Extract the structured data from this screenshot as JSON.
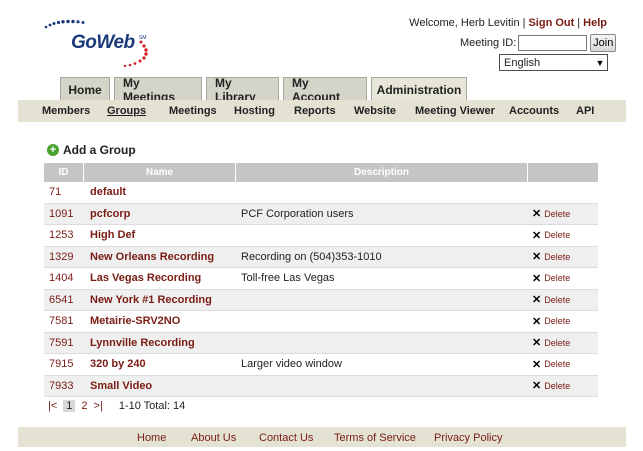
{
  "header": {
    "logo_text": "GoWeb",
    "logo_tm": "SM",
    "welcome": "Welcome, Herb Levitin",
    "sign_out": "Sign Out",
    "help": "Help",
    "meeting_id_label": "Meeting ID:",
    "meeting_id_value": "",
    "join_label": "Join",
    "language": "English"
  },
  "tabs": [
    {
      "label": "Home"
    },
    {
      "label": "My Meetings"
    },
    {
      "label": "My Library"
    },
    {
      "label": "My Account"
    },
    {
      "label": "Administration",
      "active": true
    }
  ],
  "subnav": [
    "Members",
    "Groups",
    "Meetings",
    "Hosting",
    "Reports",
    "Website",
    "Meeting Viewer",
    "Accounts",
    "API"
  ],
  "subnav_active": "Groups",
  "add_group_label": "Add a Group",
  "table": {
    "columns": [
      "ID",
      "Name",
      "Description",
      ""
    ],
    "rows": [
      {
        "id": "71",
        "name": "default",
        "description": "",
        "action": ""
      },
      {
        "id": "1091",
        "name": "pcfcorp",
        "description": "PCF Corporation users",
        "action": "Delete"
      },
      {
        "id": "1253",
        "name": "High Def",
        "description": "",
        "action": "Delete"
      },
      {
        "id": "1329",
        "name": "New Orleans Recording",
        "description": "Recording on (504)353-1010",
        "action": "Delete"
      },
      {
        "id": "1404",
        "name": "Las Vegas Recording",
        "description": "Toll-free Las Vegas",
        "action": "Delete"
      },
      {
        "id": "6541",
        "name": "New York #1 Recording",
        "description": "",
        "action": "Delete"
      },
      {
        "id": "7581",
        "name": "Metairie-SRV2NO",
        "description": "",
        "action": "Delete"
      },
      {
        "id": "7591",
        "name": "Lynnville Recording",
        "description": "",
        "action": "Delete"
      },
      {
        "id": "7915",
        "name": "320 by 240",
        "description": "Larger video window",
        "action": "Delete"
      },
      {
        "id": "7933",
        "name": "Small Video",
        "description": "",
        "action": "Delete"
      }
    ]
  },
  "pager": {
    "first": "|<",
    "pages": [
      "1",
      "2"
    ],
    "current": "1",
    "last": ">|",
    "summary": "1-10 Total: 14"
  },
  "footer": [
    "Home",
    "About Us",
    "Contact Us",
    "Terms of Service",
    "Privacy Policy"
  ],
  "colors": {
    "accent": "#7a1c14",
    "tab_bg": "#d5d4c8",
    "strip_bg": "#e3e2d3",
    "header_bg": "#c5c5c5",
    "logo_blue": "#1b3a7a",
    "logo_red": "#d0202a"
  }
}
